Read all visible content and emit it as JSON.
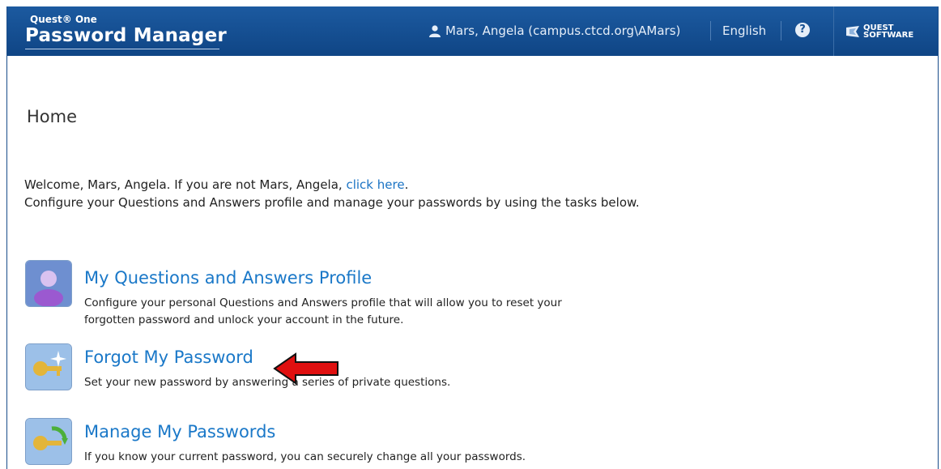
{
  "header": {
    "brand_sup": "Quest® One",
    "brand_main": "Password Manager",
    "user_name": "Mars, Angela (campus.ctcd.org\\AMars)",
    "user_icon": "user-icon",
    "language": "English",
    "help_icon": "question-circle-icon",
    "help_glyph": "?",
    "vendor_line1": "QUEST",
    "vendor_line2": "SOFTWARE",
    "colors": {
      "bar": "#0f4585",
      "accent": "#1a78c8"
    }
  },
  "page": {
    "title": "Home",
    "welcome_text": "Welcome, Mars, Angela. If you are not Mars, Angela,",
    "welcome_link": "click here",
    "welcome_end": ".",
    "subtext": "Configure your Questions and Answers profile and manage your passwords by using the tasks below."
  },
  "tasks": [
    {
      "title": "My Questions and Answers Profile",
      "icon": "person-profile-icon",
      "desc_line1": "Configure your personal Questions and Answers profile that will allow you to reset your",
      "desc_line2": "forgotten password and unlock your account in the future."
    },
    {
      "title": "Forgot My Password",
      "icon": "key-sparkle-icon",
      "desc_line1": "Set your new password by answering a series of private questions."
    },
    {
      "title": "Manage My Passwords",
      "icon": "key-refresh-icon",
      "desc_line1": "If you know your current password, you can securely change all your passwords."
    }
  ],
  "annotation": {
    "icon": "red-arrow-icon",
    "color": "#e01010"
  }
}
